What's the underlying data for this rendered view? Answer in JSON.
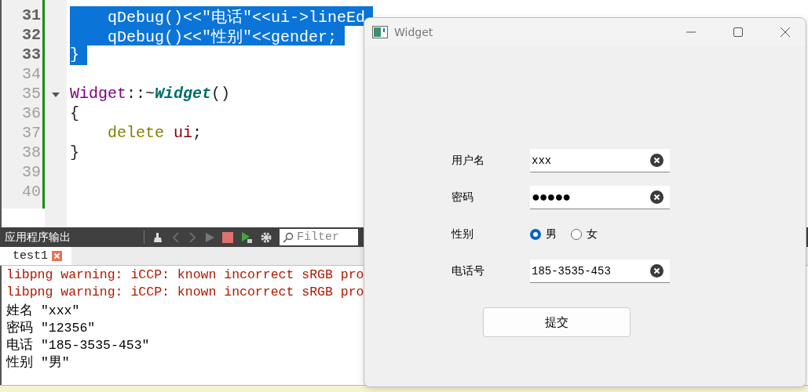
{
  "editor": {
    "lines": [
      {
        "number": "31",
        "selected": true,
        "tokens": [
          {
            "text": "    qDebug()<<\"电话\"<<ui->lineEd",
            "kind": "plain"
          }
        ]
      },
      {
        "number": "32",
        "selected": true,
        "tokens": [
          {
            "text": "    qDebug()<<\"性别\"<<gender;",
            "kind": "plain"
          }
        ]
      },
      {
        "number": "33",
        "selected": true,
        "tokens": [
          {
            "text": "}",
            "kind": "plain"
          }
        ]
      },
      {
        "number": "34",
        "selected": false
      },
      {
        "number": "35",
        "selected": false,
        "fold": true,
        "tokens": [
          {
            "text": "Widget",
            "kind": "type"
          },
          {
            "text": "::~",
            "kind": "plain"
          },
          {
            "text": "Widget",
            "kind": "func"
          },
          {
            "text": "()",
            "kind": "plain"
          }
        ]
      },
      {
        "number": "36",
        "selected": false,
        "tokens": [
          {
            "text": "{",
            "kind": "plain"
          }
        ]
      },
      {
        "number": "37",
        "selected": false,
        "tokens": [
          {
            "text": "    delete",
            "kind": "keyword"
          },
          {
            "text": " ui",
            "kind": "var"
          },
          {
            "text": ";",
            "kind": "plain"
          }
        ]
      },
      {
        "number": "38",
        "selected": false,
        "tokens": [
          {
            "text": "}",
            "kind": "plain"
          }
        ]
      },
      {
        "number": "39",
        "selected": false
      },
      {
        "number": "40",
        "selected": false
      }
    ]
  },
  "output_pane": {
    "title": "应用程序输出",
    "filter": {
      "placeholder": "Filter"
    },
    "tabs": [
      {
        "label": "test1",
        "selected": true
      }
    ],
    "lines": [
      {
        "text": "libpng warning: iCCP: known incorrect sRGB pro",
        "kind": "warning"
      },
      {
        "text": "libpng warning: iCCP: known incorrect sRGB pro",
        "kind": "warning"
      },
      {
        "text": "姓名 \"xxx\"",
        "kind": "plain"
      },
      {
        "text": "密码 \"12356\"",
        "kind": "plain"
      },
      {
        "text": "电话 \"185-3535-453\"",
        "kind": "plain"
      },
      {
        "text": "性别 \"男\"",
        "kind": "plain"
      }
    ]
  },
  "window": {
    "title": "Widget",
    "form": [
      {
        "label": "用户名",
        "kind": "text",
        "value": "xxx"
      },
      {
        "label": "密码",
        "kind": "password",
        "value": "●●●●●"
      },
      {
        "label": "性别",
        "kind": "radio",
        "options": [
          {
            "label": "男",
            "selected": true
          },
          {
            "label": "女",
            "selected": false
          }
        ]
      },
      {
        "label": "电话号",
        "kind": "text",
        "value": "185-3535-453"
      }
    ],
    "submit": "提交"
  }
}
